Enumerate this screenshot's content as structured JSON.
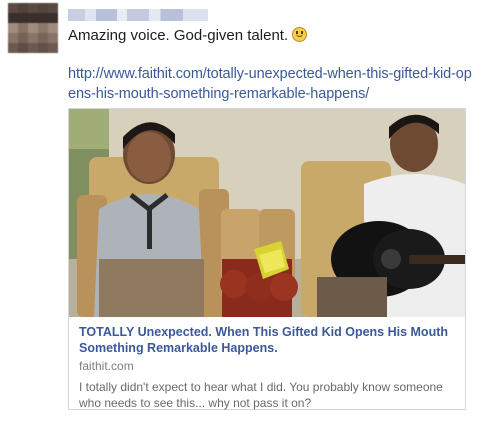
{
  "post": {
    "author_name": "",
    "message": "Amazing voice. God-given talent.",
    "link_url": "http://www.faithit.com/totally-unexpected-when-this-gifted-kid-opens-his-mouth-something-remarkable-happens/"
  },
  "preview": {
    "title": "TOTALLY Unexpected. When This Gifted Kid Opens His Mouth Something Remarkable Happens.",
    "domain": "faithit.com",
    "description": "I totally didn't expect to hear what I did. You probably know someone who needs to see this... why not pass it on?"
  },
  "icons": [
    "smiley-emoticon-icon"
  ],
  "colors": {
    "link": "#3b5998",
    "border": "#d3d6db",
    "text": "#1d1d1d",
    "muted": "#7f7f7f"
  }
}
